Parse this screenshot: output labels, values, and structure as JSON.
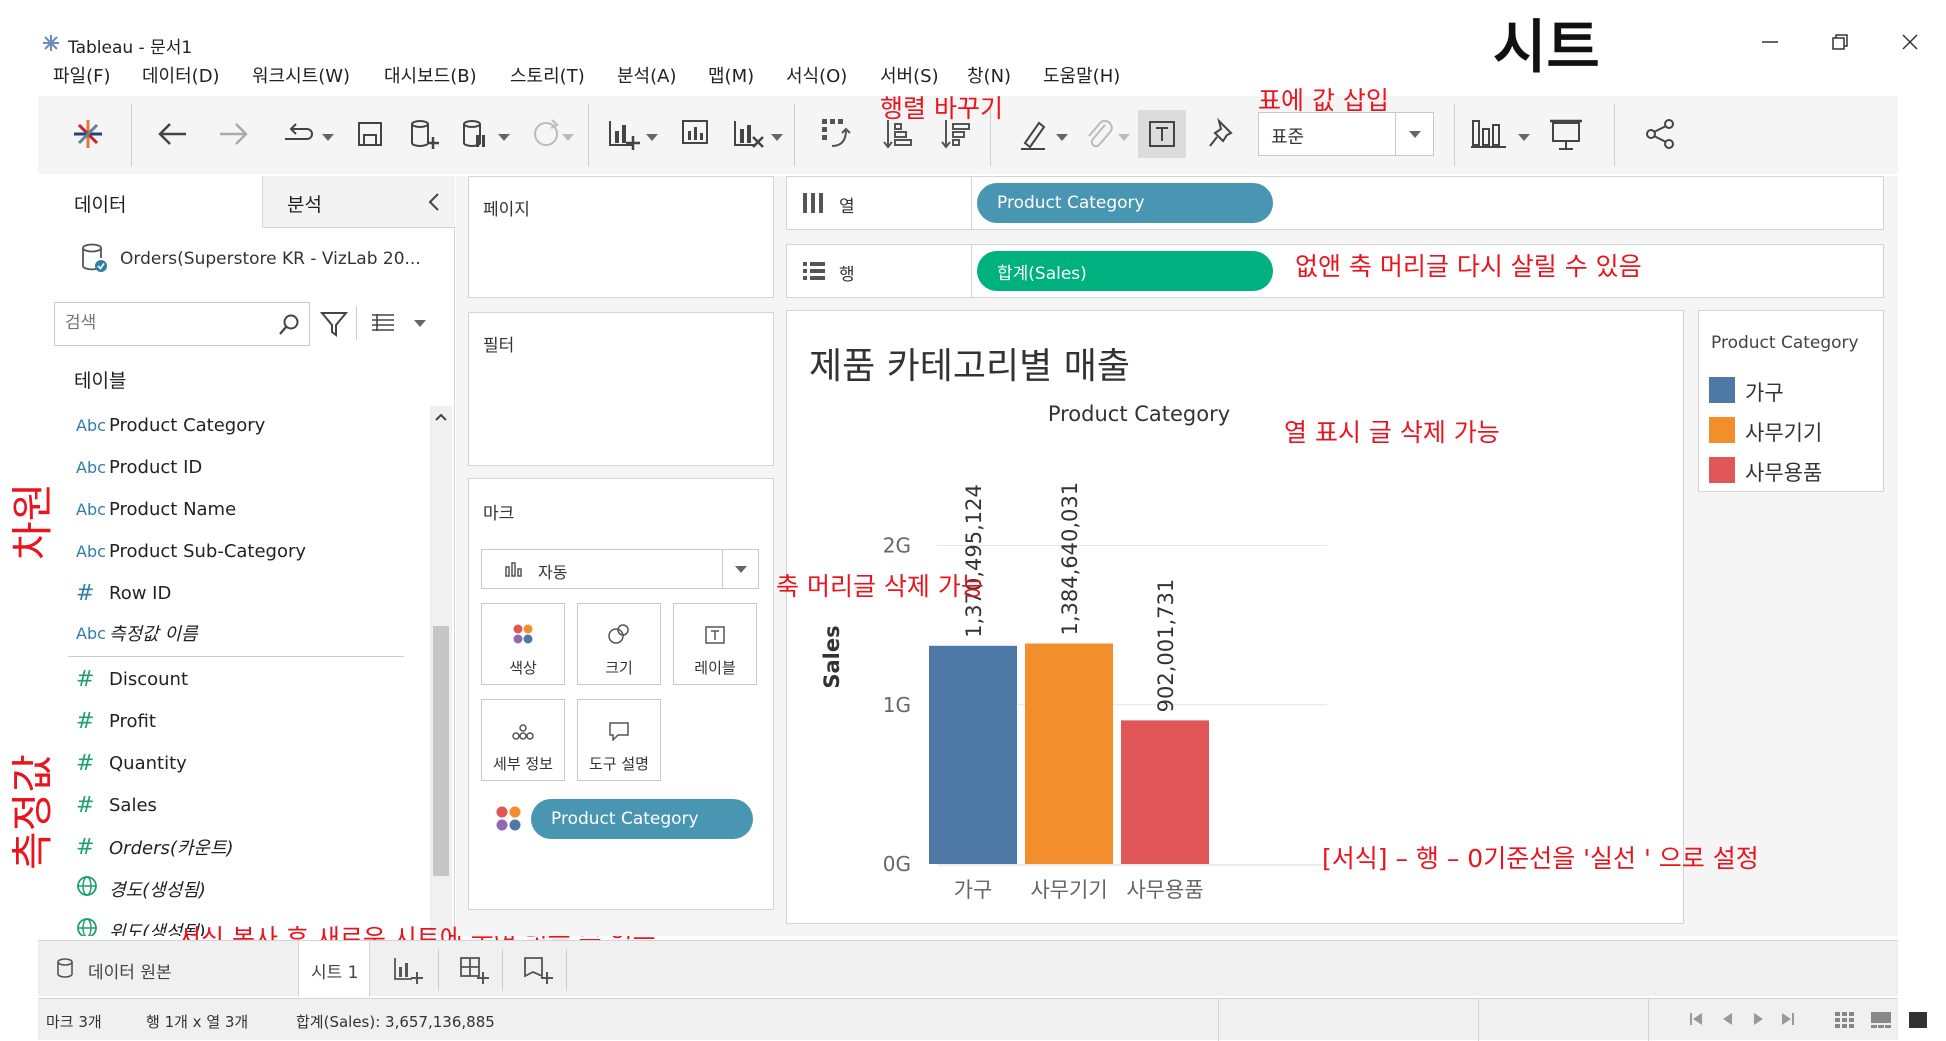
{
  "window": {
    "title": "Tableau - 문서1"
  },
  "menu": [
    "파일(F)",
    "데이터(D)",
    "워크시트(W)",
    "대시보드(B)",
    "스토리(T)",
    "분석(A)",
    "맵(M)",
    "서식(O)",
    "서버(S)",
    "창(N)",
    "도움말(H)"
  ],
  "toolbar": {
    "fit_select": "표준"
  },
  "left_panel": {
    "tab_data": "데이터",
    "tab_analysis": "분석",
    "datasource": "Orders(Superstore KR - VizLab 20...",
    "search_placeholder": "검색",
    "tables_heading": "테이블",
    "dimensions": [
      {
        "icon": "Abc",
        "label": "Product Category"
      },
      {
        "icon": "Abc",
        "label": "Product ID"
      },
      {
        "icon": "Abc",
        "label": "Product Name"
      },
      {
        "icon": "Abc",
        "label": "Product Sub-Category"
      },
      {
        "icon": "#",
        "label": "Row ID"
      },
      {
        "icon": "Abc",
        "label": "측정값 이름"
      }
    ],
    "measures": [
      {
        "icon": "#",
        "label": "Discount"
      },
      {
        "icon": "#",
        "label": "Profit"
      },
      {
        "icon": "#",
        "label": "Quantity"
      },
      {
        "icon": "#",
        "label": "Sales"
      },
      {
        "icon": "#",
        "label": "Orders(카운트)"
      },
      {
        "icon": "globe",
        "label": "경도(생성됨)"
      },
      {
        "icon": "globe",
        "label": "위도(생성됨)"
      }
    ]
  },
  "cards": {
    "pages": "페이지",
    "filters": "필터",
    "marks": "마크",
    "mark_type": "자동",
    "mark_buttons": [
      "색상",
      "크기",
      "레이블",
      "세부 정보",
      "도구 설명"
    ],
    "marks_pill": "Product Category"
  },
  "shelves": {
    "columns_label": "열",
    "columns_pill": "Product Category",
    "rows_label": "행",
    "rows_pill": "합계(Sales)"
  },
  "viz": {
    "title": "제품 카테고리별 매출",
    "header": "Product Category",
    "ylabel": "Sales"
  },
  "chart_data": {
    "type": "bar",
    "title": "제품 카테고리별 매출",
    "xlabel": "Product Category",
    "ylabel": "Sales",
    "categories": [
      "가구",
      "사무기기",
      "사무용품"
    ],
    "values": [
      1370495124,
      1384640031,
      902001731
    ],
    "value_labels": [
      "1,370,495,124",
      "1,384,640,031",
      "902,001,731"
    ],
    "colors": [
      "#4e79a7",
      "#f28e2b",
      "#e15759"
    ],
    "yticks": [
      0,
      1000000000,
      2000000000
    ],
    "ytick_labels": [
      "0G",
      "1G",
      "2G"
    ],
    "ylim": [
      0,
      2330000000
    ],
    "grid": true
  },
  "legend": {
    "title": "Product Category",
    "items": [
      {
        "label": "가구",
        "color": "#4e79a7"
      },
      {
        "label": "사무기기",
        "color": "#f28e2b"
      },
      {
        "label": "사무용품",
        "color": "#e15759"
      }
    ]
  },
  "bottom_tabs": {
    "datasource": "데이터 원본",
    "sheet": "시트 1"
  },
  "status": {
    "marks": "마크 3개",
    "rows_cols": "행 1개 x 열 3개",
    "sum": "합계(Sales): 3,657,136,885"
  },
  "annotations": {
    "sheet_heading": "시트",
    "swap": "행렬 바꾸기",
    "insert_values": "표에 값 삽입",
    "restore_axis": "없앤 축 머리글 다시 살릴 수 있음",
    "delete_header": "열 표시 글 삭제 가능",
    "delete_axis": "축 머리글 삭제 가능",
    "zero_line": "[서식] – 행 – 0기준선을 '실선 ' 으로 설정",
    "copy_format": "서식 복사 후 새로운 시트에 붙여 넣을 수 있음",
    "dimension_label": "차원",
    "measure_label": "측정값"
  }
}
